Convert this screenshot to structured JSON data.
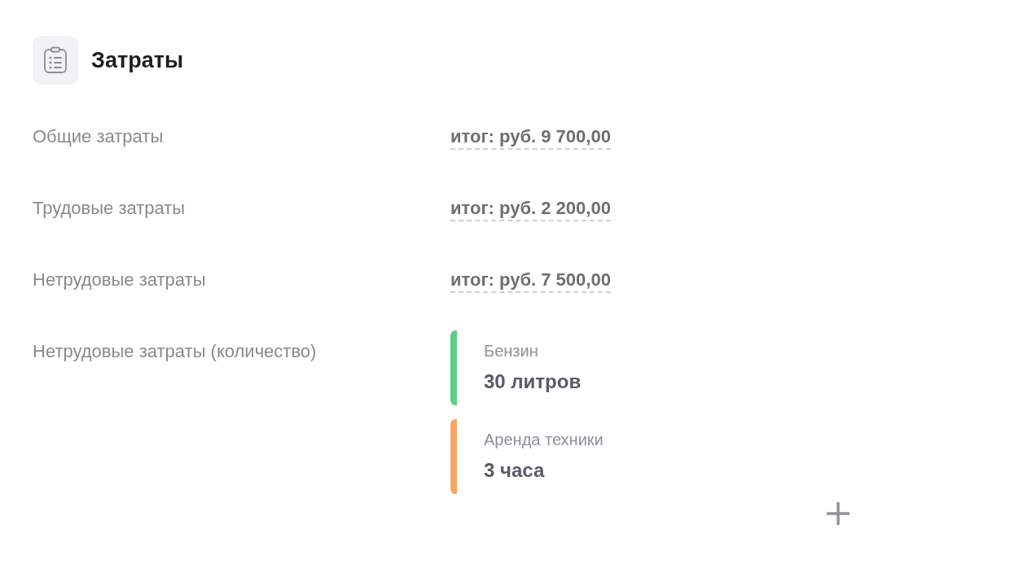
{
  "section": {
    "title": "Затраты"
  },
  "rows": [
    {
      "kind": "total",
      "label": "Общие затраты",
      "value": "итог: руб. 9 700,00"
    },
    {
      "kind": "total",
      "label": "Трудовые затраты",
      "value": "итог: руб. 2 200,00"
    },
    {
      "kind": "total",
      "label": "Нетрудовые затраты",
      "value": "итог: руб. 7 500,00"
    },
    {
      "kind": "items",
      "label": "Нетрудовые затраты (количество)",
      "items": [
        {
          "name": "Бензин",
          "amount": "30 литров",
          "color": "#5fcf86"
        },
        {
          "name": "Аренда техники",
          "amount": "3 часа",
          "color": "#fba564"
        }
      ]
    }
  ]
}
